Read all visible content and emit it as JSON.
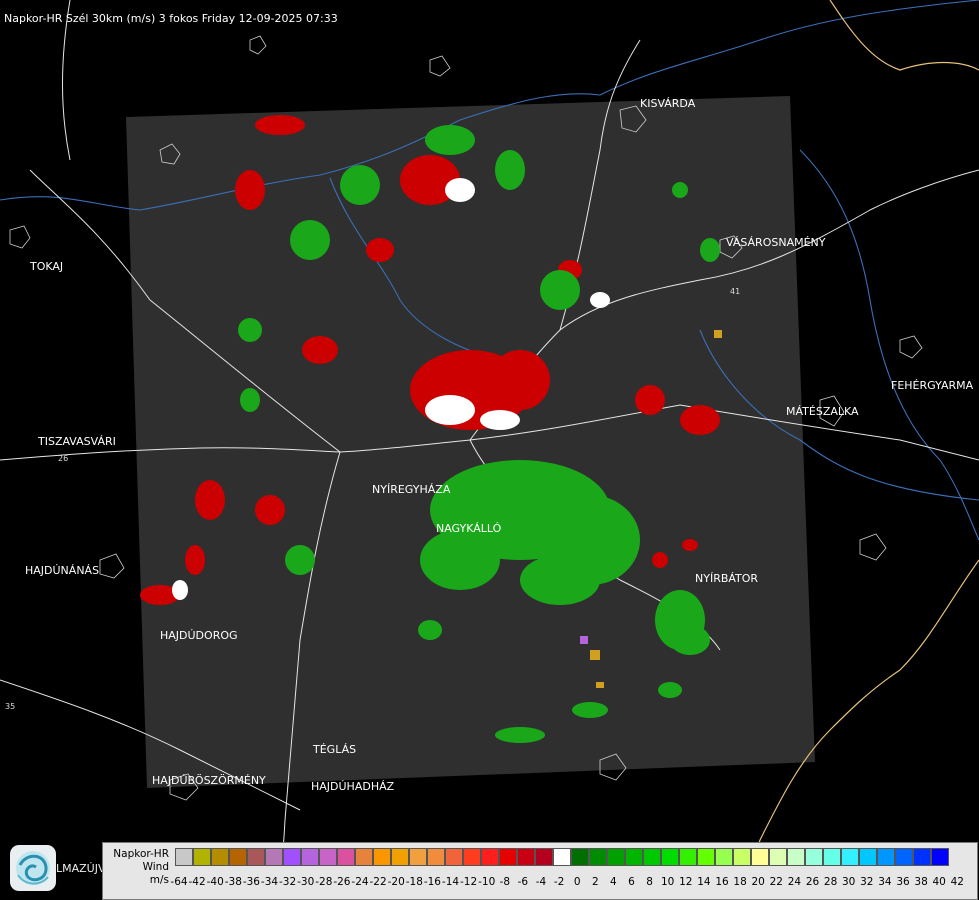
{
  "header": "Napkor-HR Szél 30km (m/s) 3 fokos Friday 12-09-2025 07:33",
  "places": {
    "kisvarda": "KISVÁRDA",
    "tokaj": "TOKAJ",
    "vasarosnameny": "VÁSÁROSNAMÉNY",
    "fehergyarmat": "FEHÉRGYARMA",
    "mateszalka": "MÁTÉSZALKA",
    "tiszavasvari": "TISZAVASVÁRI",
    "nyiregyhaza": "NYÍREGYHÁZA",
    "nagykallo": "NAGYKÁLLÓ",
    "hajdunanas": "HAJDÚNÁNÁS",
    "nyirbator": "NYÍRBÁTOR",
    "hajdudorog": "HAJDÚDOROG",
    "teglas": "TÉGLÁS",
    "hajduboszormeny": "HAJDÚBÖSZÖRMÉNY",
    "hajduhadhaz": "HAJDÚHADHÁZ"
  },
  "roads": {
    "r26": "26",
    "r35": "35",
    "r41": "41"
  },
  "logo": {
    "icon": "met-service-logo-icon",
    "text": "LMAZÚJVÁR"
  },
  "legend": {
    "title_line1": "Napkor-HR",
    "title_line2": "Wind",
    "title_line3": "m/s",
    "colors": [
      "#c8c8c8",
      "#b2b200",
      "#b48c00",
      "#b46400",
      "#a85858",
      "#b478b4",
      "#a050ff",
      "#b464dc",
      "#c864c8",
      "#dc50a0",
      "#e6823c",
      "#fa9600",
      "#f0a000",
      "#f0a03c",
      "#f08c3c",
      "#f0643c",
      "#ff3c1e",
      "#ff1e1e",
      "#e60000",
      "#c80014",
      "#b4001e",
      "#ffffff",
      "#006e00",
      "#008c00",
      "#00a000",
      "#00b400",
      "#00c800",
      "#00dc00",
      "#32f000",
      "#64ff00",
      "#96ff50",
      "#c8ff64",
      "#ffff96",
      "#dcffb4",
      "#c8ffc8",
      "#96ffdc",
      "#64ffe6",
      "#32f0ff",
      "#00c8ff",
      "#0096ff",
      "#0064ff",
      "#0032ff",
      "#0000ff"
    ],
    "ticks": [
      "-64",
      "-42",
      "-40",
      "-38",
      "-36",
      "-34",
      "-32",
      "-30",
      "-28",
      "-26",
      "-24",
      "-22",
      "-20",
      "-18",
      "-16",
      "-14",
      "-12",
      "-10",
      "-8",
      "-6",
      "-4",
      "-2",
      "0",
      "2",
      "4",
      "6",
      "8",
      "10",
      "12",
      "14",
      "16",
      "18",
      "20",
      "22",
      "24",
      "26",
      "28",
      "30",
      "32",
      "34",
      "36",
      "38",
      "40",
      "42"
    ]
  }
}
